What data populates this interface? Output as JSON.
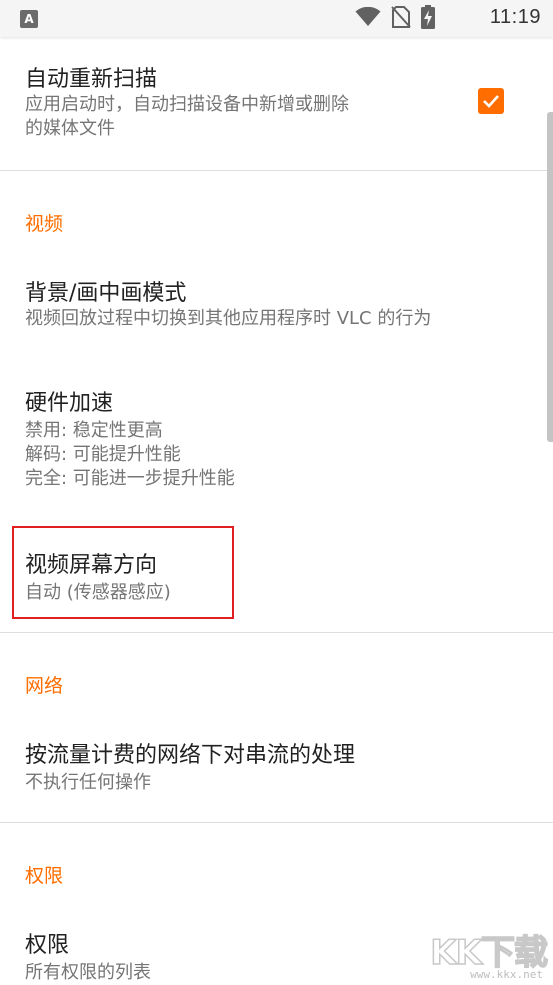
{
  "status_bar": {
    "app_icon_letter": "A",
    "time": "11:19",
    "icons": [
      "wifi-icon",
      "no-sim-icon",
      "battery-charging-icon"
    ]
  },
  "settings": {
    "auto_rescan": {
      "title": "自动重新扫描",
      "summary": "应用启动时，自动扫描设备中新增或删除\n的媒体文件",
      "checked": true
    },
    "video_category": "视频",
    "background_pip": {
      "title": "背景/画中画模式",
      "summary": "视频回放过程中切换到其他应用程序时 VLC 的行为"
    },
    "hw_accel": {
      "title": "硬件加速",
      "summary": "禁用: 稳定性更高\n解码: 可能提升性能\n完全: 可能进一步提升性能"
    },
    "screen_orientation": {
      "title": "视频屏幕方向",
      "summary": "自动 (传感器感应)"
    },
    "network_category": "网络",
    "metered_network": {
      "title": "按流量计费的网络下对串流的处理",
      "summary": "不执行任何操作"
    },
    "permissions_category": "权限",
    "permissions": {
      "title": "权限",
      "summary": "所有权限的列表"
    }
  },
  "watermark": {
    "main": "KK下载",
    "sub": "www.kkx.net"
  },
  "colors": {
    "accent": "#ff6d00",
    "highlight": "#e02020",
    "status_bar_bg": "#f5f5f5"
  }
}
